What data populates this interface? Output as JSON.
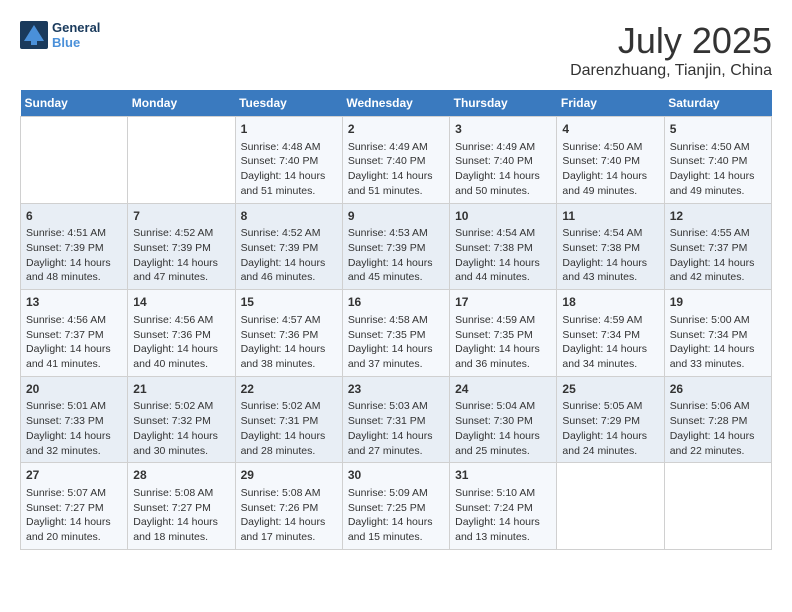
{
  "header": {
    "logo_line1": "General",
    "logo_line2": "Blue",
    "month_title": "July 2025",
    "location": "Darenzhuang, Tianjin, China"
  },
  "weekdays": [
    "Sunday",
    "Monday",
    "Tuesday",
    "Wednesday",
    "Thursday",
    "Friday",
    "Saturday"
  ],
  "weeks": [
    [
      {
        "day": "",
        "sunrise": "",
        "sunset": "",
        "daylight": ""
      },
      {
        "day": "",
        "sunrise": "",
        "sunset": "",
        "daylight": ""
      },
      {
        "day": "1",
        "sunrise": "Sunrise: 4:48 AM",
        "sunset": "Sunset: 7:40 PM",
        "daylight": "Daylight: 14 hours and 51 minutes."
      },
      {
        "day": "2",
        "sunrise": "Sunrise: 4:49 AM",
        "sunset": "Sunset: 7:40 PM",
        "daylight": "Daylight: 14 hours and 51 minutes."
      },
      {
        "day": "3",
        "sunrise": "Sunrise: 4:49 AM",
        "sunset": "Sunset: 7:40 PM",
        "daylight": "Daylight: 14 hours and 50 minutes."
      },
      {
        "day": "4",
        "sunrise": "Sunrise: 4:50 AM",
        "sunset": "Sunset: 7:40 PM",
        "daylight": "Daylight: 14 hours and 49 minutes."
      },
      {
        "day": "5",
        "sunrise": "Sunrise: 4:50 AM",
        "sunset": "Sunset: 7:40 PM",
        "daylight": "Daylight: 14 hours and 49 minutes."
      }
    ],
    [
      {
        "day": "6",
        "sunrise": "Sunrise: 4:51 AM",
        "sunset": "Sunset: 7:39 PM",
        "daylight": "Daylight: 14 hours and 48 minutes."
      },
      {
        "day": "7",
        "sunrise": "Sunrise: 4:52 AM",
        "sunset": "Sunset: 7:39 PM",
        "daylight": "Daylight: 14 hours and 47 minutes."
      },
      {
        "day": "8",
        "sunrise": "Sunrise: 4:52 AM",
        "sunset": "Sunset: 7:39 PM",
        "daylight": "Daylight: 14 hours and 46 minutes."
      },
      {
        "day": "9",
        "sunrise": "Sunrise: 4:53 AM",
        "sunset": "Sunset: 7:39 PM",
        "daylight": "Daylight: 14 hours and 45 minutes."
      },
      {
        "day": "10",
        "sunrise": "Sunrise: 4:54 AM",
        "sunset": "Sunset: 7:38 PM",
        "daylight": "Daylight: 14 hours and 44 minutes."
      },
      {
        "day": "11",
        "sunrise": "Sunrise: 4:54 AM",
        "sunset": "Sunset: 7:38 PM",
        "daylight": "Daylight: 14 hours and 43 minutes."
      },
      {
        "day": "12",
        "sunrise": "Sunrise: 4:55 AM",
        "sunset": "Sunset: 7:37 PM",
        "daylight": "Daylight: 14 hours and 42 minutes."
      }
    ],
    [
      {
        "day": "13",
        "sunrise": "Sunrise: 4:56 AM",
        "sunset": "Sunset: 7:37 PM",
        "daylight": "Daylight: 14 hours and 41 minutes."
      },
      {
        "day": "14",
        "sunrise": "Sunrise: 4:56 AM",
        "sunset": "Sunset: 7:36 PM",
        "daylight": "Daylight: 14 hours and 40 minutes."
      },
      {
        "day": "15",
        "sunrise": "Sunrise: 4:57 AM",
        "sunset": "Sunset: 7:36 PM",
        "daylight": "Daylight: 14 hours and 38 minutes."
      },
      {
        "day": "16",
        "sunrise": "Sunrise: 4:58 AM",
        "sunset": "Sunset: 7:35 PM",
        "daylight": "Daylight: 14 hours and 37 minutes."
      },
      {
        "day": "17",
        "sunrise": "Sunrise: 4:59 AM",
        "sunset": "Sunset: 7:35 PM",
        "daylight": "Daylight: 14 hours and 36 minutes."
      },
      {
        "day": "18",
        "sunrise": "Sunrise: 4:59 AM",
        "sunset": "Sunset: 7:34 PM",
        "daylight": "Daylight: 14 hours and 34 minutes."
      },
      {
        "day": "19",
        "sunrise": "Sunrise: 5:00 AM",
        "sunset": "Sunset: 7:34 PM",
        "daylight": "Daylight: 14 hours and 33 minutes."
      }
    ],
    [
      {
        "day": "20",
        "sunrise": "Sunrise: 5:01 AM",
        "sunset": "Sunset: 7:33 PM",
        "daylight": "Daylight: 14 hours and 32 minutes."
      },
      {
        "day": "21",
        "sunrise": "Sunrise: 5:02 AM",
        "sunset": "Sunset: 7:32 PM",
        "daylight": "Daylight: 14 hours and 30 minutes."
      },
      {
        "day": "22",
        "sunrise": "Sunrise: 5:02 AM",
        "sunset": "Sunset: 7:31 PM",
        "daylight": "Daylight: 14 hours and 28 minutes."
      },
      {
        "day": "23",
        "sunrise": "Sunrise: 5:03 AM",
        "sunset": "Sunset: 7:31 PM",
        "daylight": "Daylight: 14 hours and 27 minutes."
      },
      {
        "day": "24",
        "sunrise": "Sunrise: 5:04 AM",
        "sunset": "Sunset: 7:30 PM",
        "daylight": "Daylight: 14 hours and 25 minutes."
      },
      {
        "day": "25",
        "sunrise": "Sunrise: 5:05 AM",
        "sunset": "Sunset: 7:29 PM",
        "daylight": "Daylight: 14 hours and 24 minutes."
      },
      {
        "day": "26",
        "sunrise": "Sunrise: 5:06 AM",
        "sunset": "Sunset: 7:28 PM",
        "daylight": "Daylight: 14 hours and 22 minutes."
      }
    ],
    [
      {
        "day": "27",
        "sunrise": "Sunrise: 5:07 AM",
        "sunset": "Sunset: 7:27 PM",
        "daylight": "Daylight: 14 hours and 20 minutes."
      },
      {
        "day": "28",
        "sunrise": "Sunrise: 5:08 AM",
        "sunset": "Sunset: 7:27 PM",
        "daylight": "Daylight: 14 hours and 18 minutes."
      },
      {
        "day": "29",
        "sunrise": "Sunrise: 5:08 AM",
        "sunset": "Sunset: 7:26 PM",
        "daylight": "Daylight: 14 hours and 17 minutes."
      },
      {
        "day": "30",
        "sunrise": "Sunrise: 5:09 AM",
        "sunset": "Sunset: 7:25 PM",
        "daylight": "Daylight: 14 hours and 15 minutes."
      },
      {
        "day": "31",
        "sunrise": "Sunrise: 5:10 AM",
        "sunset": "Sunset: 7:24 PM",
        "daylight": "Daylight: 14 hours and 13 minutes."
      },
      {
        "day": "",
        "sunrise": "",
        "sunset": "",
        "daylight": ""
      },
      {
        "day": "",
        "sunrise": "",
        "sunset": "",
        "daylight": ""
      }
    ]
  ]
}
